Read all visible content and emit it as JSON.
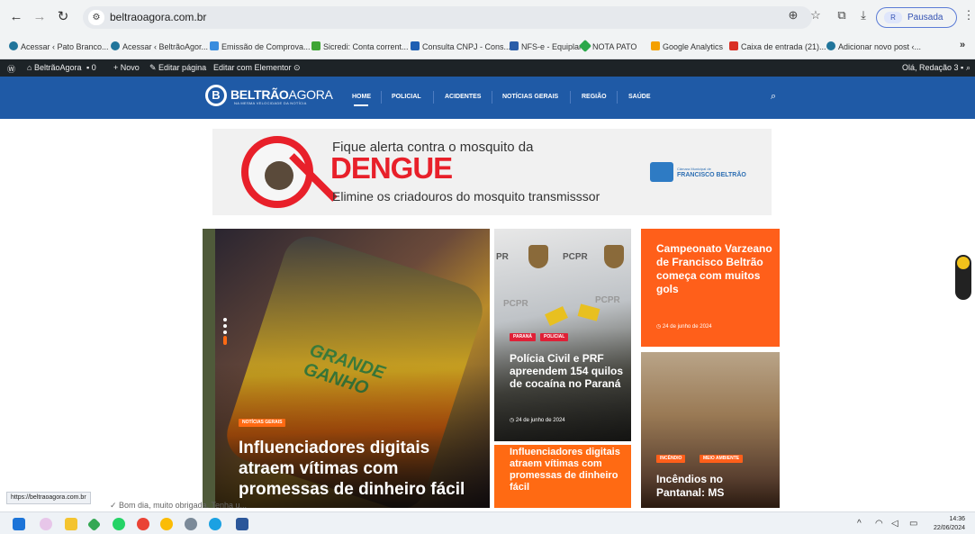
{
  "browser": {
    "url": "beltraoagora.com.br",
    "profile_label": "Pausada",
    "profile_initials": "R"
  },
  "bookmarks": [
    {
      "label": "Acessar ‹ Pato Branco...",
      "icon": "wp-icon",
      "color": "#21759b"
    },
    {
      "label": "Acessar ‹ BeltrãoAgor...",
      "icon": "wp-icon",
      "color": "#21759b"
    },
    {
      "label": "Emissão de Comprova...",
      "icon": "gov-icon",
      "color": "#3a8dde"
    },
    {
      "label": "Sicredi: Conta corrent...",
      "icon": "sicredi-icon",
      "color": "#3fa535"
    },
    {
      "label": "Consulta CNPJ - Cons...",
      "icon": "cnpj-icon",
      "color": "#1e5fb3"
    },
    {
      "label": "NFS-e - Equiplano",
      "icon": "equiplano-icon",
      "color": "#2b5ea8"
    },
    {
      "label": "NOTA PATO",
      "icon": "diamond-icon",
      "color": "#2ba84a"
    },
    {
      "label": "Google Analytics",
      "icon": "analytics-icon",
      "color": "#f4a000"
    },
    {
      "label": "Caixa de entrada (21)...",
      "icon": "gmail-icon",
      "color": "#d93025"
    },
    {
      "label": "Adicionar novo post ‹...",
      "icon": "wp-icon",
      "color": "#21759b"
    }
  ],
  "wp_admin": {
    "site": "BeltrãoAgora",
    "comments": "0",
    "new": "Novo",
    "edit_page": "Editar página",
    "elementor": "Editar com Elementor",
    "greeting": "Olá, Redação 3"
  },
  "site": {
    "logo_main": "BELTRÃO",
    "logo_thin": "AGORA",
    "logo_sub": "NA MESMA VELOCIDADE DA NOTÍCIA",
    "menu": [
      "HOME",
      "POLICIAL",
      "ACIDENTES",
      "NOTÍCIAS GERAIS",
      "REGIÃO",
      "SAÚDE"
    ]
  },
  "banner": {
    "line1": "Fique alerta contra o mosquito da",
    "line2": "DENGUE",
    "line3": "Elimine os criadouros do mosquito transmisssor",
    "org_small": "Câmara Municipal de",
    "org_name": "FRANCISCO BELTRÃO"
  },
  "posts": {
    "hero": {
      "tag": "NOTÍCIAS GERAIS",
      "title": "Influenciadores digitais atraem vítimas com promessas de dinheiro fácil",
      "image_text": "GRANDE GANHO"
    },
    "police": {
      "tags": [
        "PARANÁ",
        "POLICIAL"
      ],
      "title": "Polícia Civil e PRF apreendem 154 quilos de cocaína no Paraná",
      "date": "24 de junho de 2024",
      "image_labels": [
        "PR",
        "PCPR",
        "PCPR",
        "PCPR"
      ]
    },
    "influencers_small": {
      "title": "Influenciadores digitais atraem vítimas com promessas de dinheiro fácil"
    },
    "football": {
      "title": "Campeonato Varzeano de Francisco Beltrão começa com muitos gols",
      "date": "24 de junho de 2024"
    },
    "fire": {
      "tags": [
        "INCÊNDIO",
        "MEIO AMBIENTE"
      ],
      "title": "Incêndios no Pantanal: MS"
    }
  },
  "status": {
    "link_url": "https://beltraoagora.com.br",
    "notification": "Bom dia, muito obrigada. Tenha u..."
  },
  "taskbar": {
    "time": "14:36",
    "date": "22/06/2024"
  }
}
